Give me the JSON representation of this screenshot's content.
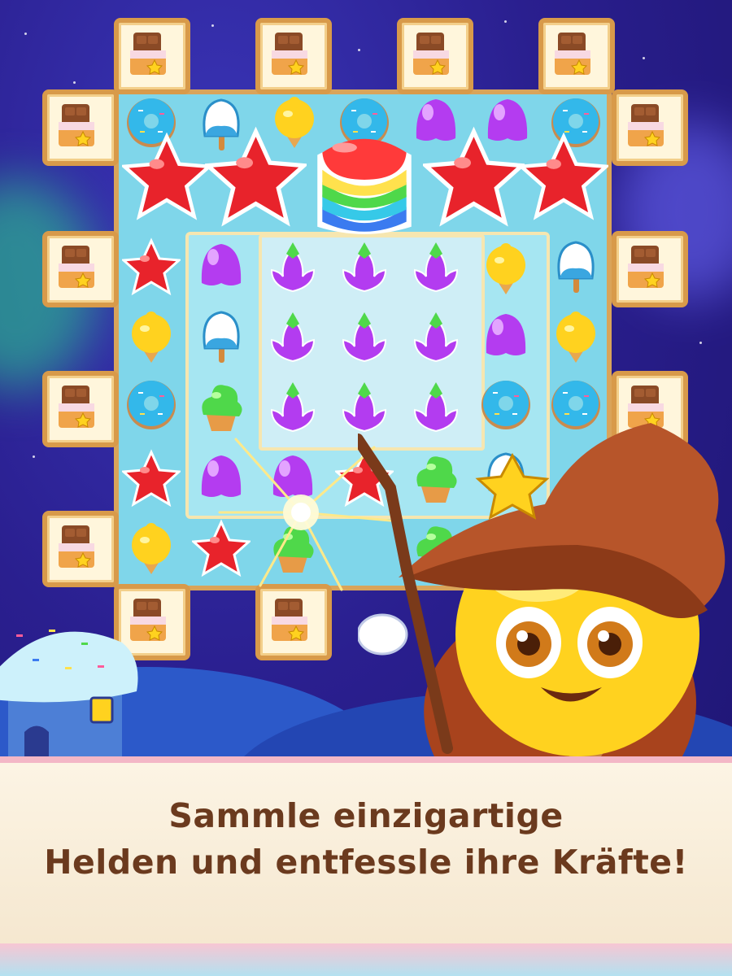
{
  "caption": {
    "line1": "Sammle einzigartige",
    "line2": "Helden und entfessle ihre Kräfte!"
  },
  "colors": {
    "sky": "#2a1f8f",
    "board": "#7fd6ea",
    "frame": "#d89a4a",
    "caption_text": "#6b3a1e",
    "panel": "#fcf4e4",
    "star_red": "#e8232b"
  },
  "icons": [
    "chocolate-box-icon",
    "donut-icon",
    "popsicle-icon",
    "jelly-icon",
    "star-candy-icon",
    "lemon-icecream-icon",
    "cupcake-icon",
    "lotus-icon",
    "rainbow-cake-icon",
    "wizard-hero",
    "candy-house"
  ]
}
